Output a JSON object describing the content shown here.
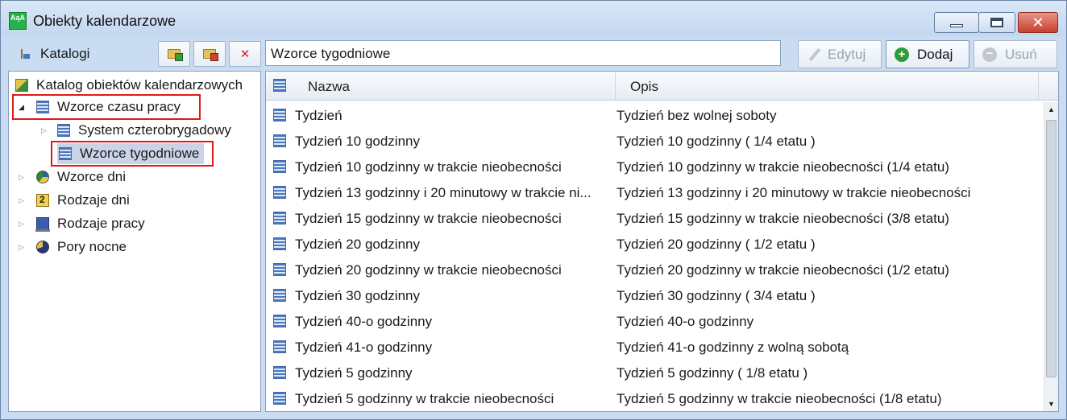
{
  "window": {
    "title": "Obiekty kalendarzowe",
    "app_icon_text": "AąA"
  },
  "left_toolbar": {
    "catalogs_label": "Katalogi"
  },
  "search": {
    "value": "Wzorce tygodniowe"
  },
  "actions": {
    "edit_label": "Edytuj",
    "add_label": "Dodaj",
    "delete_label": "Usuń"
  },
  "tree": {
    "root": "Katalog obiektów kalendarzowych",
    "items": [
      {
        "label": "Wzorce czasu pracy",
        "icon": "grid-icon"
      },
      {
        "label": "System czterobrygadowy",
        "icon": "grid-icon"
      },
      {
        "label": "Wzorce tygodniowe",
        "icon": "grid-icon"
      },
      {
        "label": "Wzorce dni",
        "icon": "pie-icon"
      },
      {
        "label": "Rodzaje dni",
        "icon": "calendar-icon"
      },
      {
        "label": "Rodzaje pracy",
        "icon": "computer-icon"
      },
      {
        "label": "Pory nocne",
        "icon": "night-icon"
      }
    ]
  },
  "list": {
    "columns": [
      "Nazwa",
      "Opis"
    ],
    "rows": [
      {
        "name": "Tydzień",
        "desc": "Tydzień bez wolnej soboty"
      },
      {
        "name": "Tydzień 10 godzinny",
        "desc": "Tydzień 10 godzinny ( 1/4 etatu )"
      },
      {
        "name": "Tydzień 10 godzinny w trakcie nieobecności",
        "desc": "Tydzień 10 godzinny w trakcie nieobecności (1/4 etatu)"
      },
      {
        "name": "Tydzień 13 godzinny i 20 minutowy w trakcie ni...",
        "desc": "Tydzień 13 godzinny i 20 minutowy w trakcie nieobecności"
      },
      {
        "name": "Tydzień 15 godzinny w trakcie nieobecności",
        "desc": "Tydzień 15 godzinny w trakcie nieobecności (3/8 etatu)"
      },
      {
        "name": "Tydzień 20 godzinny",
        "desc": "Tydzień 20 godzinny ( 1/2 etatu )"
      },
      {
        "name": "Tydzień 20 godzinny w trakcie nieobecności",
        "desc": "Tydzień 20 godzinny w trakcie nieobecności (1/2 etatu)"
      },
      {
        "name": "Tydzień 30 godzinny",
        "desc": "Tydzień 30 godzinny ( 3/4 etatu )"
      },
      {
        "name": "Tydzień 40-o godzinny",
        "desc": "Tydzień 40-o godzinny"
      },
      {
        "name": "Tydzień 41-o godzinny",
        "desc": "Tydzień 41-o godzinny z wolną sobotą"
      },
      {
        "name": "Tydzień 5 godzinny",
        "desc": "Tydzień 5 godzinny ( 1/8 etatu )"
      },
      {
        "name": "Tydzień 5 godzinny w trakcie nieobecności",
        "desc": "Tydzień 5 godzinny w trakcie nieobecności (1/8 etatu)"
      }
    ]
  },
  "colors": {
    "highlight_border": "#e01818",
    "selection_bg": "#cbd3e6",
    "window_bg": "#c9dcf1"
  }
}
